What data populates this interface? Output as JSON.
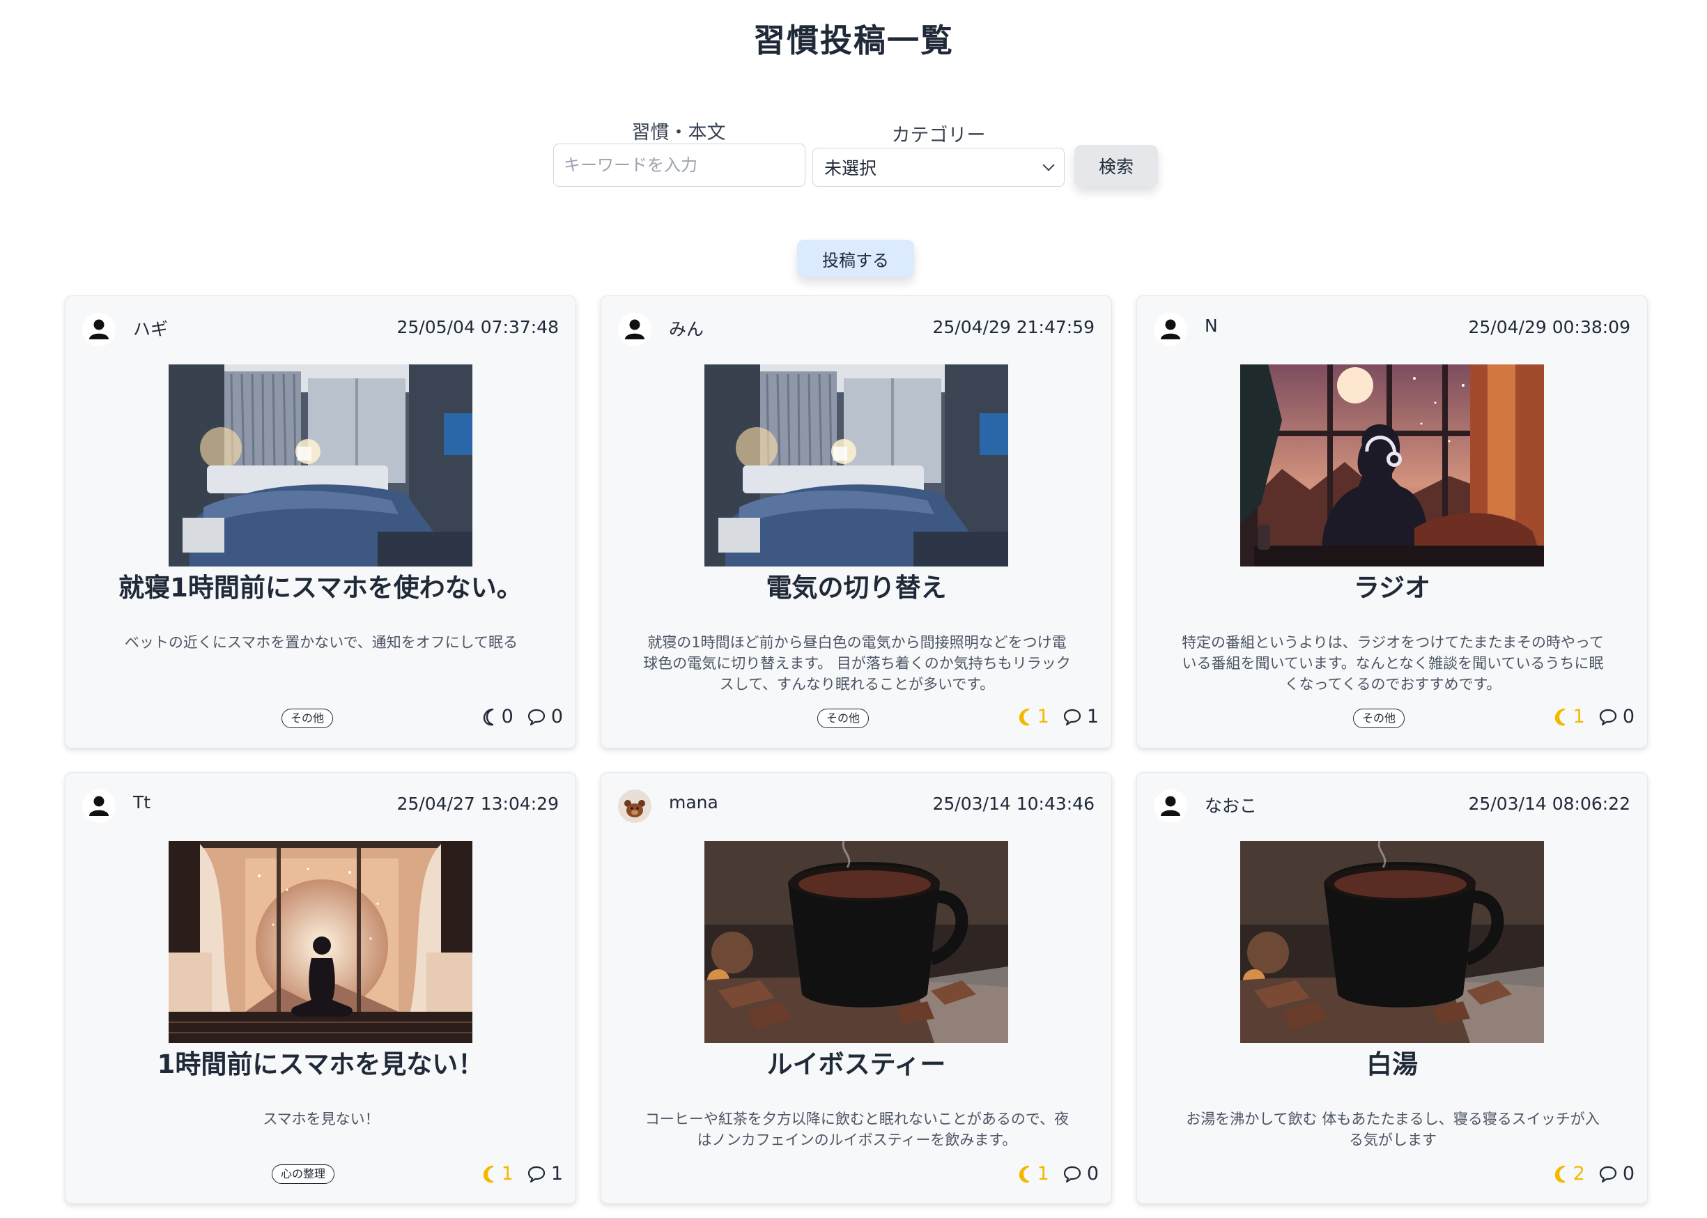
{
  "page": {
    "title": "習慣投稿一覧"
  },
  "search": {
    "keyword_label": "習慣・本文",
    "keyword_placeholder": "キーワードを入力",
    "keyword_value": "",
    "category_label": "カテゴリー",
    "category_selected": "未選択",
    "submit_label": "検索"
  },
  "post_button": {
    "label": "投稿する"
  },
  "colors": {
    "accent_like": "#f5b800",
    "post_button_bg": "#dbeafe",
    "card_bg": "#f7f8fa"
  },
  "posts": [
    {
      "user": "ハギ",
      "avatar": "user-silhouette-icon",
      "timestamp": "25/05/04 07:37:48",
      "image": "dim-bedroom-photo",
      "title": "就寝1時間前にスマホを使わない。",
      "body": "ベットの近くにスマホを置かないで、通知をオフにして眠る",
      "tag": "その他",
      "likes": "0",
      "comments": "0",
      "liked": false
    },
    {
      "user": "みん",
      "avatar": "user-silhouette-icon",
      "timestamp": "25/04/29 21:47:59",
      "image": "dim-bedroom-photo",
      "title": "電気の切り替え",
      "body": "就寝の1時間ほど前から昼白色の電気から間接照明などをつけ電球色の電気に切り替えます。 目が落ち着くのか気持ちもリラックスして、すんなり眠れることが多いです。",
      "tag": "その他",
      "likes": "1",
      "comments": "1",
      "liked": true
    },
    {
      "user": "N",
      "avatar": "user-silhouette-icon",
      "timestamp": "25/04/29 00:38:09",
      "image": "headphones-night-illustration",
      "title": "ラジオ",
      "body": "特定の番組というよりは、ラジオをつけてたまたまその時やっている番組を聞いています。なんとなく雑談を聞いているうちに眠くなってくるのでおすすめです。",
      "tag": "その他",
      "likes": "1",
      "comments": "0",
      "liked": true
    },
    {
      "user": "Tt",
      "avatar": "user-silhouette-icon",
      "timestamp": "25/04/27 13:04:29",
      "image": "meditation-window-illustration",
      "title": "1時間前にスマホを見ない！",
      "body": "スマホを見ない！",
      "tag": "心の整理",
      "likes": "1",
      "comments": "1",
      "liked": true
    },
    {
      "user": "mana",
      "avatar": "bear-avatar-icon",
      "timestamp": "25/03/14 10:43:46",
      "image": "hot-drink-mug-photo",
      "title": "ルイボスティー",
      "body": "コーヒーや紅茶を夕方以降に飲むと眠れないことがあるので、夜はノンカフェインのルイボスティーを飲みます。",
      "tag": "",
      "likes": "1",
      "comments": "0",
      "liked": true
    },
    {
      "user": "なおこ",
      "avatar": "user-silhouette-icon",
      "timestamp": "25/03/14 08:06:22",
      "image": "hot-drink-mug-photo",
      "title": "白湯",
      "body": "お湯を沸かして飲む 体もあたたまるし、寝る寝るスイッチが入る気がします",
      "tag": "",
      "likes": "2",
      "comments": "0",
      "liked": true
    }
  ]
}
